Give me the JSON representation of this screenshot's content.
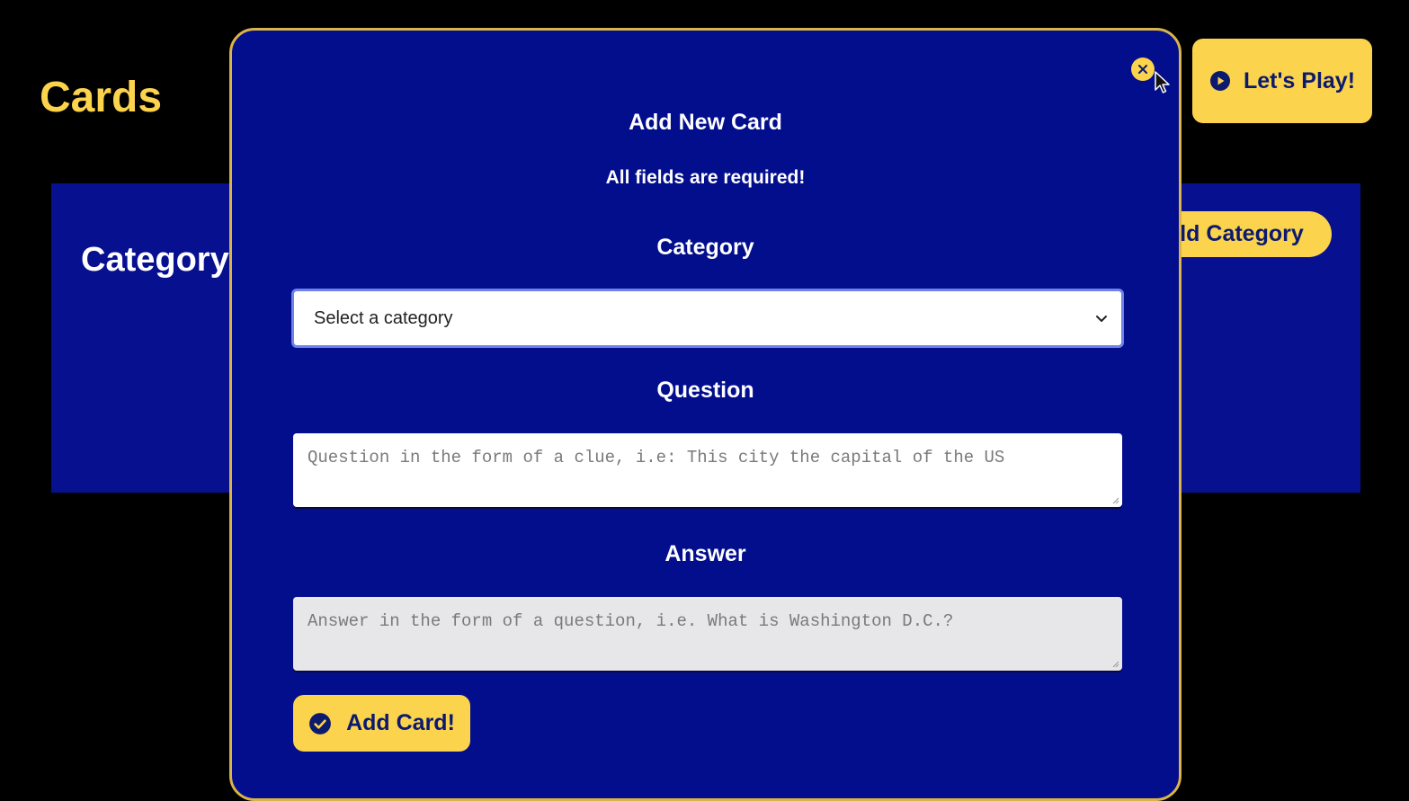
{
  "page": {
    "title": "Cards",
    "play_button": "Let's Play!"
  },
  "panel": {
    "heading": "Category",
    "add_category_button": "ld Category"
  },
  "modal": {
    "title": "Add New Card",
    "note": "All fields are required!",
    "category_label": "Category",
    "category_select_value": "Select a category",
    "question_label": "Question",
    "question_placeholder": "Question in the form of a clue, i.e: This city the capital of the US",
    "answer_label": "Answer",
    "answer_placeholder": "Answer in the form of a question, i.e. What is Washington D.C.?",
    "submit_button": "Add Card!"
  },
  "colors": {
    "background": "#000000",
    "panel": "#07108f",
    "modal": "#030e8d",
    "accent": "#fcd34d",
    "button_text": "#0b1a6e"
  },
  "icons": {
    "play": "play-circle-icon",
    "close": "close-icon",
    "dropdown": "chevron-down-icon",
    "check": "check-circle-icon",
    "cursor": "mouse-pointer-icon"
  }
}
